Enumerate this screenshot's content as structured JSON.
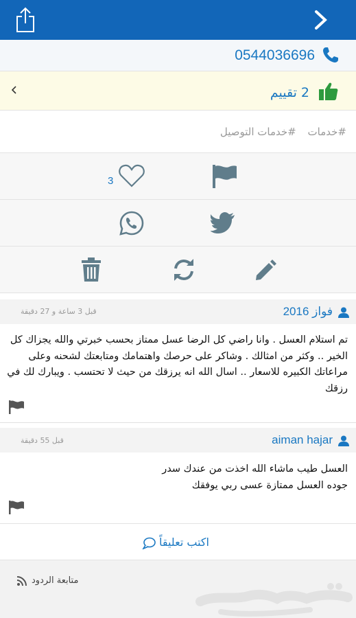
{
  "colors": {
    "brand": "#1266b8",
    "link": "#1a78c2",
    "like_green": "#2e9a3e",
    "icon_gray": "#607d8b"
  },
  "header": {
    "share_icon": "share-icon",
    "back_icon": "chevron-right-icon"
  },
  "contact": {
    "phone": "0544036696"
  },
  "rating": {
    "label": "2 تقييم"
  },
  "tags": [
    "#خدمات",
    "#خدمات التوصيل"
  ],
  "actions": {
    "like_count": "3"
  },
  "comments": [
    {
      "author": "فواز 2016",
      "time": "قبل 3 ساعة و 27 دقيقة",
      "lines": [
        "تم استلام العسل . وانا راضي كل الرضا عسل ممتاز بحسب خبرتي والله يجزاك كل",
        "الخير .. وكثر من امثالك . وشاكر على حرصك واهتمامك ومتابعتك لشحنه وعلى",
        "مراعاتك الكبيره للاسعار .. اسال الله انه يرزقك من حيث لا تحتسب . ويبارك لك في",
        "رزقك"
      ]
    },
    {
      "author": "aiman hajar",
      "time": "قبل 55 دقيقة",
      "lines": [
        "العسل طيب ماشاء الله اخذت من عندك سدر",
        "جوده العسل ممتازة عسى ربي يوفقك"
      ]
    }
  ],
  "write_comment": "اكتب تعليقاً",
  "footer": {
    "follow_label": "متابعة الردود"
  }
}
